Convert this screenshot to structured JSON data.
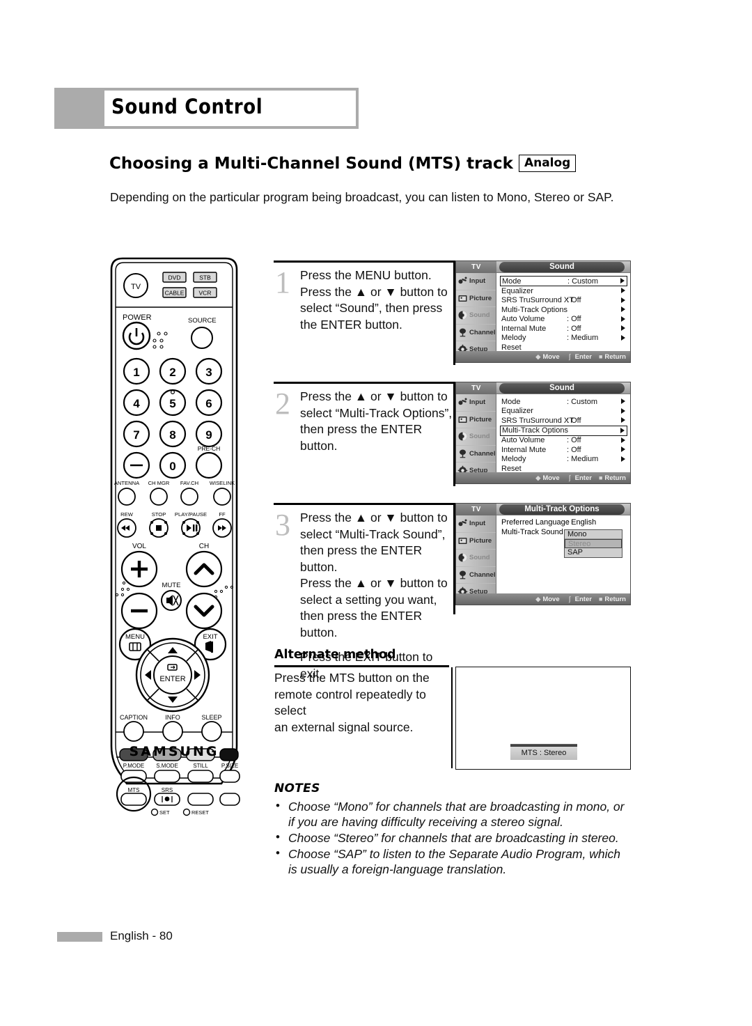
{
  "chapter": {
    "title": "Sound Control"
  },
  "section": {
    "heading": "Choosing a Multi-Channel Sound (MTS) track",
    "badge": "Analog",
    "intro": "Depending on the particular program being broadcast, you can listen to Mono, Stereo or SAP."
  },
  "steps": [
    {
      "num": "1",
      "line1": "Press the MENU button.",
      "line2": "Press the ▲ or ▼ button to",
      "line3": "select “Sound”, then press",
      "line4": "the ENTER button."
    },
    {
      "num": "2",
      "line1": "Press the ▲ or ▼ button to",
      "line2": "select “Multi-Track Options”,",
      "line3": "then press the ENTER button.",
      "line4": ""
    },
    {
      "num": "3",
      "line1": "Press the ▲ or ▼ button to",
      "line2": "select “Multi-Track Sound”,",
      "line3": "then press the ENTER button.",
      "line4": "Press the ▲ or ▼ button to",
      "line5": "select a setting you want,",
      "line6": "then press the ENTER button.",
      "line7": "Press the EXIT button to exit."
    }
  ],
  "osd": {
    "tv_label": "TV",
    "sidebar": [
      {
        "label": "Input",
        "icon": "input-icon",
        "active": false
      },
      {
        "label": "Picture",
        "icon": "picture-icon",
        "active": false
      },
      {
        "label": "Sound",
        "icon": "sound-icon",
        "active": true
      },
      {
        "label": "Channel",
        "icon": "channel-icon",
        "active": false
      },
      {
        "label": "Setup",
        "icon": "setup-icon",
        "active": false
      }
    ],
    "footer": {
      "move": "Move",
      "enter": "Enter",
      "return": "Return"
    },
    "screen1": {
      "title": "Sound",
      "rows": [
        {
          "label": "Mode",
          "value": ": Custom",
          "arrow": true,
          "selected": true
        },
        {
          "label": "Equalizer",
          "value": "",
          "arrow": true,
          "selected": false
        },
        {
          "label": "SRS TruSurround XT",
          "value": ": Off",
          "arrow": true,
          "selected": false
        },
        {
          "label": "Multi-Track Options",
          "value": "",
          "arrow": true,
          "selected": false
        },
        {
          "label": "Auto Volume",
          "value": ": Off",
          "arrow": true,
          "selected": false
        },
        {
          "label": "Internal Mute",
          "value": ": Off",
          "arrow": true,
          "selected": false
        },
        {
          "label": "Melody",
          "value": ": Medium",
          "arrow": true,
          "selected": false
        },
        {
          "label": "Reset",
          "value": "",
          "arrow": false,
          "selected": false
        }
      ]
    },
    "screen2": {
      "title": "Sound",
      "rows": [
        {
          "label": "Mode",
          "value": ": Custom",
          "arrow": true,
          "selected": false
        },
        {
          "label": "Equalizer",
          "value": "",
          "arrow": true,
          "selected": false
        },
        {
          "label": "SRS TruSurround XT",
          "value": ": Off",
          "arrow": true,
          "selected": false
        },
        {
          "label": "Multi-Track Options",
          "value": "",
          "arrow": true,
          "selected": true
        },
        {
          "label": "Auto Volume",
          "value": ": Off",
          "arrow": true,
          "selected": false
        },
        {
          "label": "Internal Mute",
          "value": ": Off",
          "arrow": true,
          "selected": false
        },
        {
          "label": "Melody",
          "value": ": Medium",
          "arrow": true,
          "selected": false
        },
        {
          "label": "Reset",
          "value": "",
          "arrow": false,
          "selected": false
        }
      ]
    },
    "screen3": {
      "title": "Multi-Track Options",
      "pref_label": "Preferred Language",
      "pref_value": ": English",
      "mts_label": "Multi-Track Sound",
      "options": [
        {
          "label": "Mono",
          "selected": false
        },
        {
          "label": "Stereo",
          "selected": true
        },
        {
          "label": "SAP",
          "selected": false
        }
      ]
    }
  },
  "alternate": {
    "heading": "Alternate method",
    "line1": "Press the MTS button on the",
    "line2": "remote control repeatedly to select",
    "line3": "an external signal source.",
    "tv_osd_chip": "MTS : Stereo"
  },
  "notes": {
    "heading": "NOTES",
    "items": [
      "Choose “Mono” for channels that are broadcasting in mono, or if you are having difficulty receiving a stereo signal.",
      "Choose “Stereo” for channels that are broadcasting in stereo.",
      "Choose “SAP” to listen to the Separate Audio Program, which is usually a foreign-language translation."
    ]
  },
  "footer": {
    "text": "English - 80"
  },
  "remote": {
    "brand": "SAMSUNG",
    "device_buttons": [
      "DVD",
      "STB",
      "CABLE",
      "VCR"
    ],
    "tv_button": "TV",
    "power_label": "POWER",
    "source_label": "SOURCE",
    "keypad": [
      "1",
      "2",
      "3",
      "4",
      "5",
      "6",
      "7",
      "8",
      "9",
      "—",
      "0",
      ""
    ],
    "pre_ch_label": "PRE-CH",
    "function_row": [
      "ANTENNA",
      "CH MGR",
      "FAV.CH",
      "WISELINK"
    ],
    "transport_row": [
      "REW",
      "STOP",
      "PLAY/PAUSE",
      "FF"
    ],
    "vol_label": "VOL",
    "ch_label": "CH",
    "mute_label": "MUTE",
    "menu_label": "MENU",
    "exit_label": "EXIT",
    "enter_label": "ENTER",
    "bottom_row": [
      "CAPTION",
      "INFO",
      "SLEEP"
    ],
    "color_row": [
      "P.MODE",
      "S.MODE",
      "STILL",
      "P.SIZE"
    ],
    "last_row": [
      "MTS",
      "SRS"
    ],
    "set_label": "SET",
    "reset_label": "RESET",
    "highlight": "MTS"
  },
  "colors": {
    "accent_gray": "#ababab",
    "step_number": "#bdbdbd",
    "osd_dark": "#3a3a3a"
  }
}
